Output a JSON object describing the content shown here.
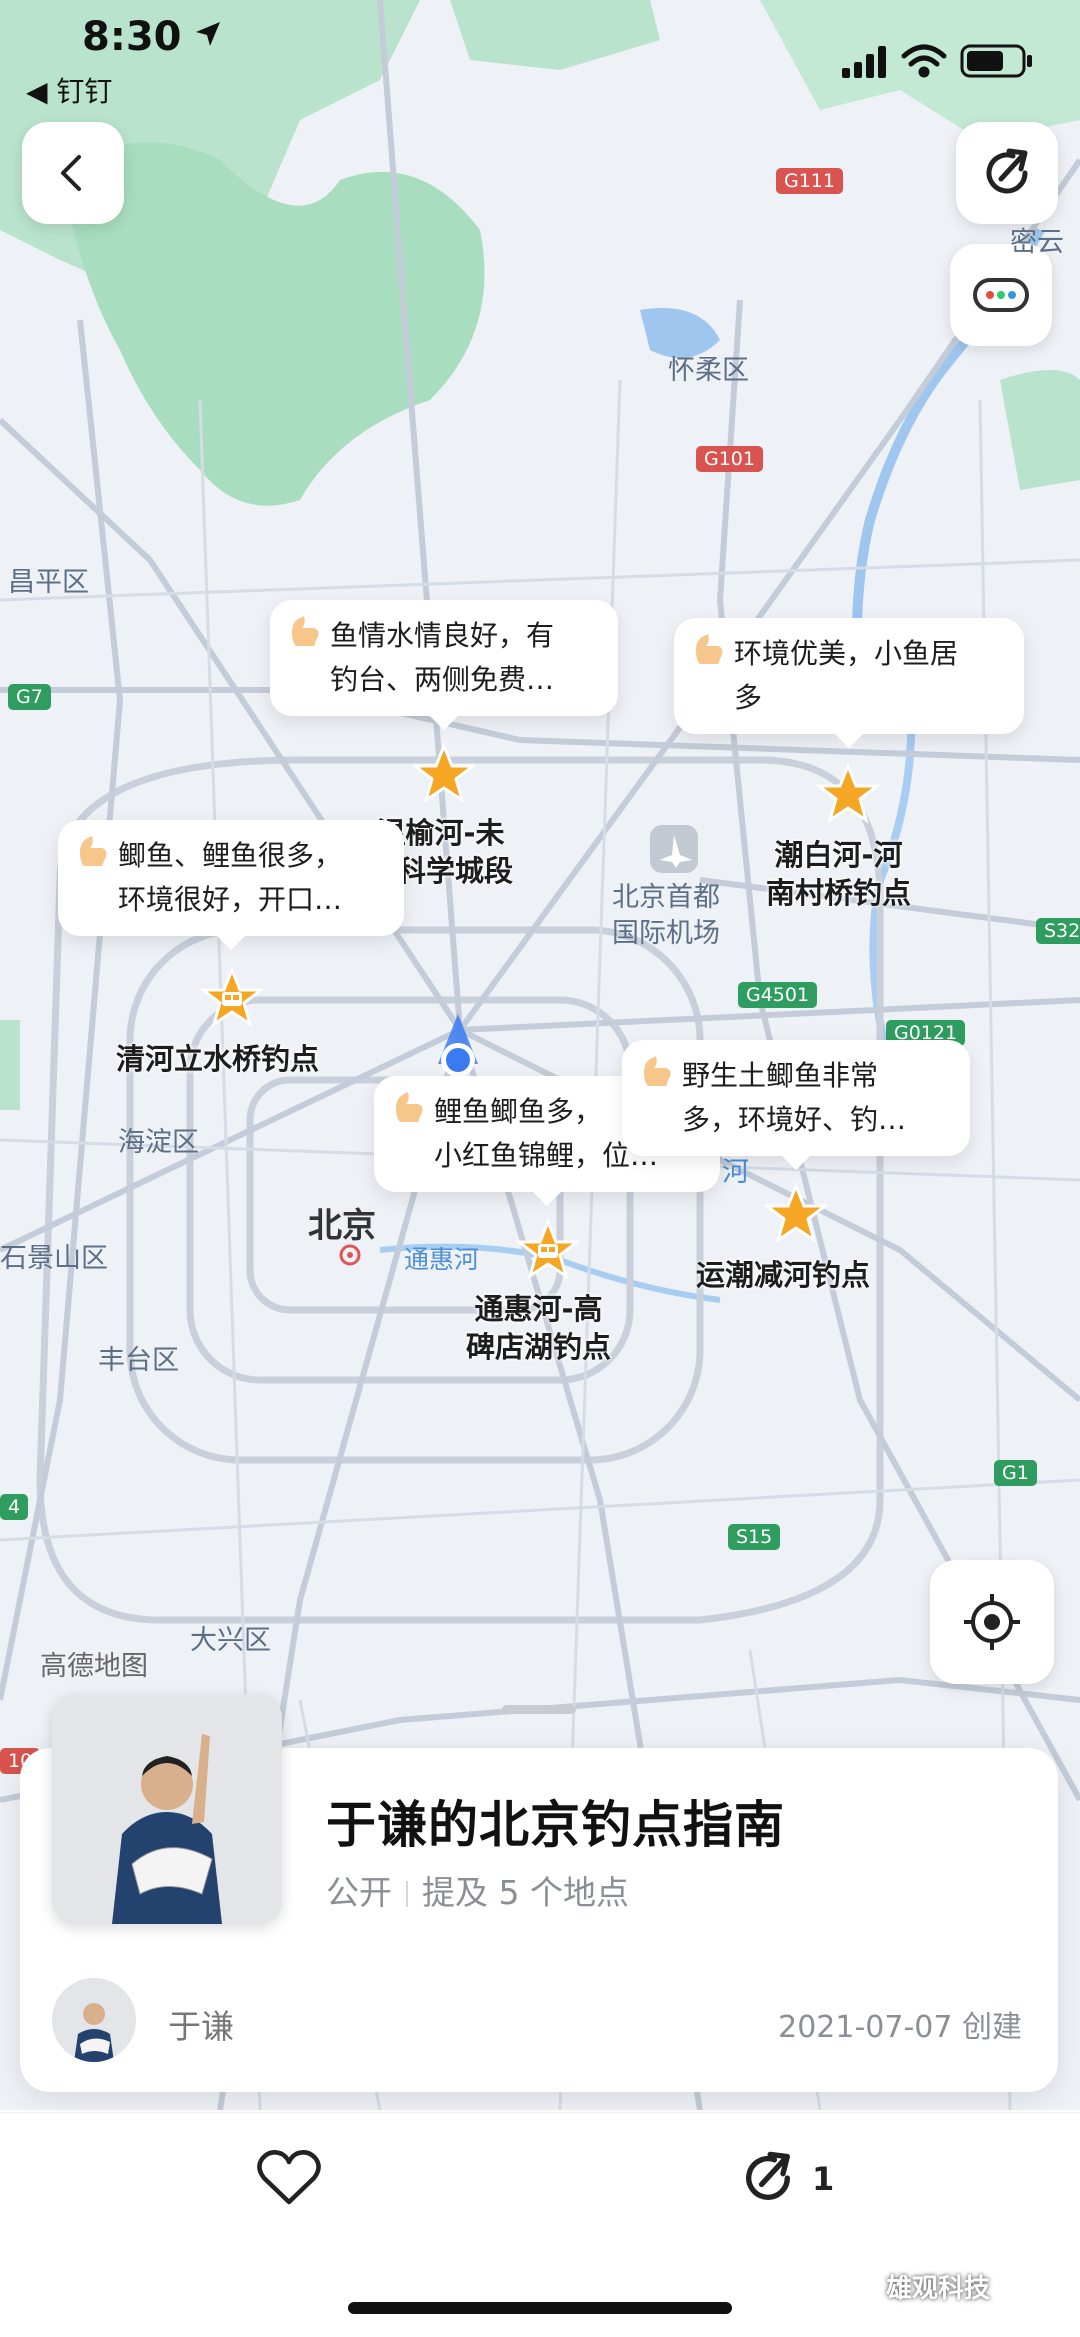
{
  "status_bar": {
    "time": "8:30",
    "back_app": "◀ 钉钉"
  },
  "map": {
    "district_labels": [
      "怀柔区",
      "昌平区",
      "海淀区",
      "石景山区",
      "丰台区",
      "大兴区",
      "北京"
    ],
    "area_labels": [
      "北京首都\n国际机场",
      "通惠河"
    ],
    "road_shields": [
      "G111",
      "G101",
      "G7",
      "S32",
      "G4501",
      "G0121",
      "G1",
      "S15"
    ],
    "partial_labels": [
      "密云",
      "4",
      "10",
      "河"
    ],
    "copyright": "高德地图",
    "spots": [
      {
        "name": "温榆河-未\n来科学城段",
        "comment": "鱼情水情良好，有\n钓台、两侧免费…",
        "pin": "star"
      },
      {
        "name": "潮白河-河\n南村桥钓点",
        "comment": "环境优美，小鱼居\n多",
        "pin": "star"
      },
      {
        "name": "清河立水桥钓点",
        "comment": "鲫鱼、鲤鱼很多，\n环境很好，开口…",
        "pin": "bus"
      },
      {
        "name": "通惠河-高\n碑店湖钓点",
        "comment": "鲤鱼鲫鱼多，\n小红鱼锦鲤，位…",
        "pin": "bus"
      },
      {
        "name": "运潮减河钓点",
        "comment": "野生土鲫鱼非常\n多，环境好、钓…",
        "pin": "star"
      }
    ]
  },
  "card": {
    "title": "于谦的北京钓点指南",
    "visibility": "公开",
    "places": "提及 5 个地点",
    "author": "于谦",
    "created": "2021-07-07 创建"
  },
  "actions": {
    "share_count": "1"
  },
  "watermark": "雄观科技",
  "colors": {
    "accent": "#3a7bf2",
    "star": "#f5a623",
    "road_green": "#2e9d5f",
    "road_red": "#d9534f"
  }
}
